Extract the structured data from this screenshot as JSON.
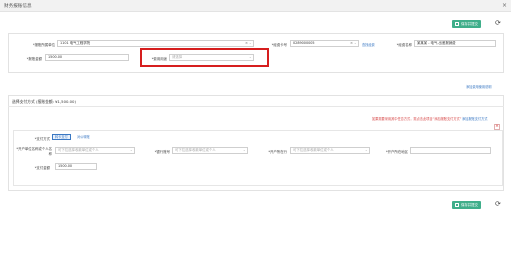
{
  "window": {
    "title": "财务报账信息"
  },
  "toolbar": {
    "save_label": "保存并提交",
    "refresh_icon": "refresh-icon"
  },
  "form": {
    "unit": {
      "label": "*报账所属单位",
      "value": "1101 电气工程学院"
    },
    "project_no": {
      "label": "*经费卡号",
      "value": "0289000005",
      "link": "查找经费"
    },
    "project_name": {
      "label": "*经费名称",
      "value": "某某某 - 电气-出差报销费"
    },
    "amount": {
      "label": "*报账金额",
      "value": "1500.00"
    },
    "usage": {
      "label": "*费用用途",
      "placeholder": "请选择"
    }
  },
  "links": {
    "add_usage": "添加费用使用说明"
  },
  "payment": {
    "section_title": "选择支付方式 (报账金额: ¥1,500.00)",
    "red_note": "如果需要采用其中任意方式，需点击此项目“添加报账支付方式”",
    "add_link": "添加报账支付方式",
    "method_label": "*支付方式",
    "methods": [
      "转卡支付",
      "对公转账"
    ],
    "payee": {
      "label": "*开户单位名称或个人名称",
      "placeholder": "可下拉选择收款单位或个人"
    },
    "account": {
      "label": "*银行账号",
      "placeholder": "可下拉选择收款单位或个人"
    },
    "bank": {
      "label": "*开户所在行",
      "placeholder": "可下拉选择收款单位或个人"
    },
    "bank_city": {
      "label": "*开户所在地区",
      "value": ""
    },
    "pay_amount": {
      "label": "*支付金额",
      "value": "1500.00"
    }
  },
  "colors": {
    "accent_green": "#3fae8a",
    "highlight_red": "#d61e1e",
    "link_blue": "#3a78c3"
  }
}
